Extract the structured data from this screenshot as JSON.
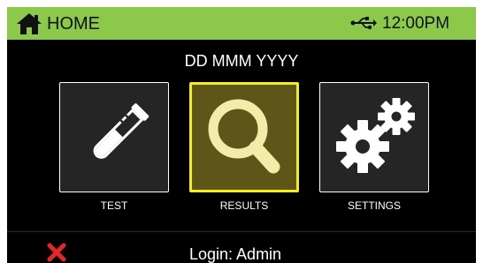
{
  "header": {
    "title": "HOME",
    "time": "12:00PM",
    "home_icon": "home-icon",
    "usb_icon": "usb-icon",
    "background": "#8cc94b"
  },
  "date": "DD MMM YYYY",
  "tiles": [
    {
      "label": "TEST",
      "icon": "test-tube-icon",
      "selected": false
    },
    {
      "label": "RESULTS",
      "icon": "magnifier-icon",
      "selected": true
    },
    {
      "label": "SETTINGS",
      "icon": "gears-icon",
      "selected": false
    }
  ],
  "footer": {
    "login_text": "Login: Admin",
    "close_icon": "close-icon",
    "close_color": "#e8232a"
  },
  "colors": {
    "selected_border": "#f5ee1c",
    "selected_fill": "#5e5618",
    "magnifier": "#f3eca8"
  }
}
